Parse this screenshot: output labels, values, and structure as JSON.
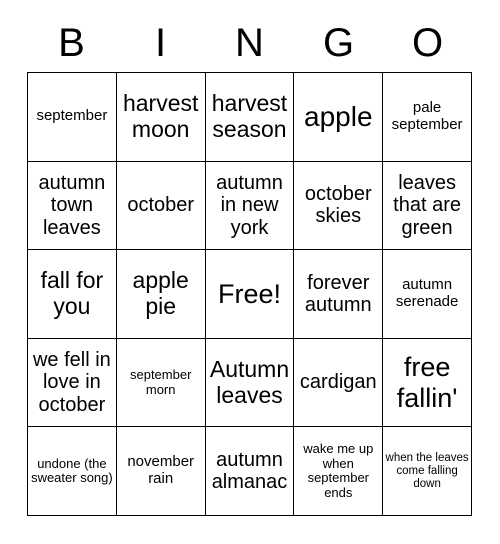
{
  "header": {
    "letters": [
      "B",
      "I",
      "N",
      "G",
      "O"
    ]
  },
  "grid": {
    "rows": 5,
    "columns": 5,
    "cells": [
      {
        "text": "september",
        "size": "fs-xs"
      },
      {
        "text": "harvest moon",
        "size": "fs-md"
      },
      {
        "text": "harvest season",
        "size": "fs-md"
      },
      {
        "text": "apple",
        "size": "fs-xl"
      },
      {
        "text": "pale september",
        "size": "fs-xs"
      },
      {
        "text": "autumn town leaves",
        "size": "fs-sm"
      },
      {
        "text": "october",
        "size": "fs-sm"
      },
      {
        "text": "autumn in new york",
        "size": "fs-sm"
      },
      {
        "text": "october skies",
        "size": "fs-sm"
      },
      {
        "text": "leaves that are green",
        "size": "fs-sm"
      },
      {
        "text": "fall for you",
        "size": "fs-md"
      },
      {
        "text": "apple pie",
        "size": "fs-md"
      },
      {
        "text": "Free!",
        "size": "fs-lg"
      },
      {
        "text": "forever autumn",
        "size": "fs-sm"
      },
      {
        "text": "autumn serenade",
        "size": "fs-xs"
      },
      {
        "text": "we fell in love in october",
        "size": "fs-sm"
      },
      {
        "text": "september morn",
        "size": "fs-xxs"
      },
      {
        "text": "Autumn leaves",
        "size": "fs-md"
      },
      {
        "text": "cardigan",
        "size": "fs-sm"
      },
      {
        "text": "free fallin'",
        "size": "fs-lg"
      },
      {
        "text": "undone (the sweater song)",
        "size": "fs-xxs"
      },
      {
        "text": "november rain",
        "size": "fs-xs"
      },
      {
        "text": "autumn almanac",
        "size": "fs-sm"
      },
      {
        "text": "wake me up when september ends",
        "size": "fs-xxs"
      },
      {
        "text": "when the leaves come falling down",
        "size": "fs-min"
      }
    ]
  },
  "colors": {
    "background": "#ffffff",
    "text": "#000000",
    "border": "#000000"
  }
}
